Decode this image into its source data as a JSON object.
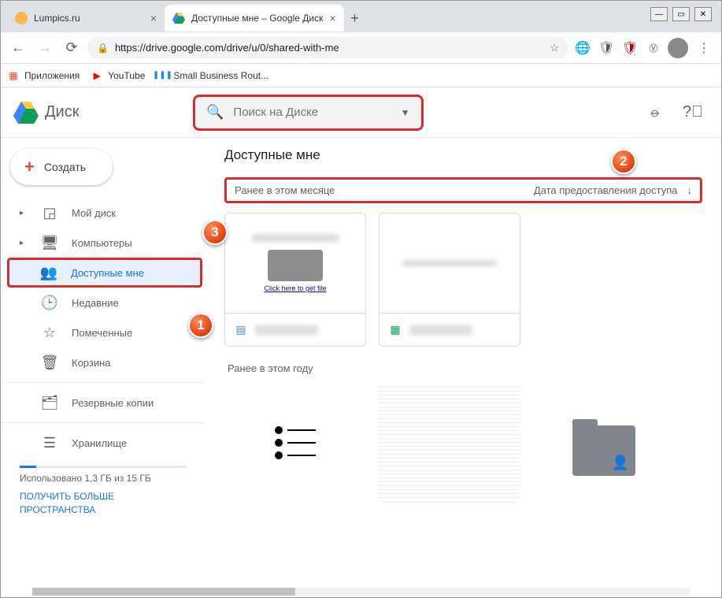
{
  "window": {
    "min": "—",
    "max": "▭",
    "close": "✕"
  },
  "tabs": [
    {
      "title": "Lumpics.ru",
      "active": false
    },
    {
      "title": "Доступные мне – Google Диск",
      "active": true
    }
  ],
  "addr": {
    "url": "https://drive.google.com/drive/u/0/shared-with-me"
  },
  "bookmarks": {
    "apps": "Приложения",
    "youtube": "YouTube",
    "sbr": "Small Business Rout..."
  },
  "drive": {
    "logo_text": "Диск",
    "search_placeholder": "Поиск на Диске"
  },
  "sidebar": {
    "create": "Создать",
    "items": {
      "mydrive": "Мой диск",
      "computers": "Компьютеры",
      "shared": "Доступные мне",
      "recent": "Недавние",
      "starred": "Помеченные",
      "trash": "Корзина",
      "backups": "Резервные копии",
      "storage": "Хранилище"
    },
    "storage_used": "Использовано 1,3 ГБ из 15 ГБ",
    "storage_link": "ПОЛУЧИТЬ БОЛЬШЕ ПРОСТРАНСТВА"
  },
  "main": {
    "title": "Доступные мне",
    "section1": "Ранее в этом месяце",
    "sort_label": "Дата предоставления доступа",
    "section2": "Ранее в этом году",
    "file1_link": "Click here to get file"
  },
  "badges": {
    "b1": "1",
    "b2": "2",
    "b3": "3"
  }
}
